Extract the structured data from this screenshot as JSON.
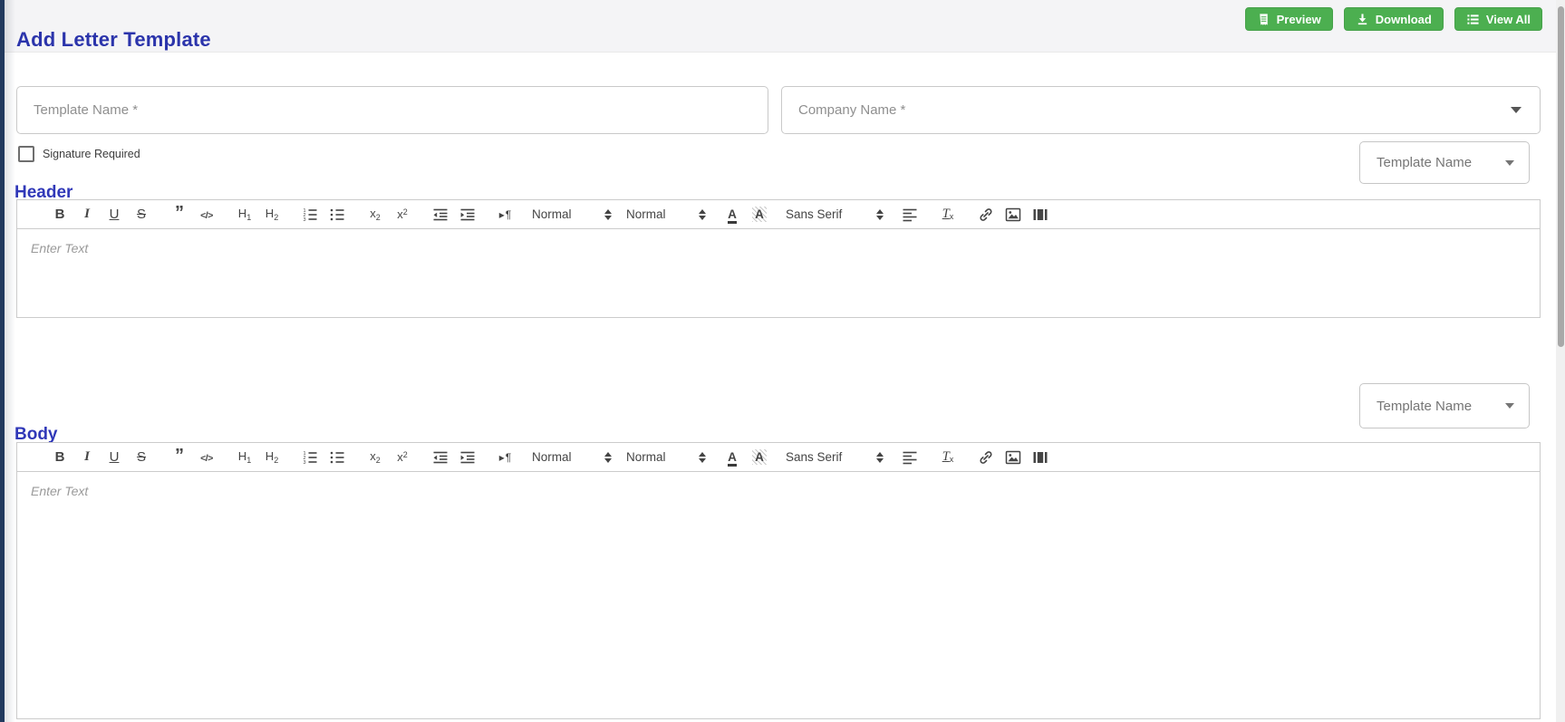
{
  "title": "Add Letter Template",
  "topbar": {
    "buttons": [
      {
        "label": "Preview",
        "icon": "receipt-icon"
      },
      {
        "label": "Download",
        "icon": "download-icon"
      },
      {
        "label": "View All",
        "icon": "list-view-icon"
      }
    ]
  },
  "form": {
    "template_name": {
      "placeholder": "Template Name *",
      "value": ""
    },
    "company_name": {
      "placeholder": "Company Name *",
      "value": ""
    },
    "signature_required": {
      "label": "Signature Required",
      "checked": false
    }
  },
  "sections": [
    {
      "title": "Header",
      "merge_dropdown": {
        "value": "Template Name"
      },
      "editor": {
        "placeholder": "Enter Text",
        "value": ""
      }
    },
    {
      "title": "Body",
      "merge_dropdown": {
        "value": "Template Name"
      },
      "editor": {
        "placeholder": "Enter Text",
        "value": ""
      }
    }
  ],
  "editor_toolbar": {
    "groups": [
      {
        "items": [
          "bold",
          "italic",
          "underline",
          "strike"
        ]
      },
      {
        "items": [
          "blockquote",
          "code-block"
        ]
      },
      {
        "items": [
          "header-1",
          "header-2"
        ]
      },
      {
        "items": [
          "ordered-list",
          "bullet-list"
        ]
      },
      {
        "items": [
          "subscript",
          "superscript"
        ]
      },
      {
        "items": [
          "outdent",
          "indent"
        ]
      },
      {
        "items": [
          "direction-rtl"
        ]
      },
      {
        "items": [
          "size-select"
        ]
      },
      {
        "items": [
          "heading-select"
        ]
      },
      {
        "items": [
          "text-color",
          "background-color"
        ]
      },
      {
        "items": [
          "font-select"
        ]
      },
      {
        "items": [
          "align"
        ]
      },
      {
        "items": [
          "clean-formatting"
        ]
      },
      {
        "items": [
          "insert-link",
          "insert-image",
          "insert-video"
        ]
      }
    ],
    "selects": {
      "size-select": "Normal",
      "heading-select": "Normal",
      "font-select": "Sans Serif"
    }
  },
  "colors": {
    "title_blue": "#2b34ab",
    "section_blue": "#3038b8",
    "button_green": "#4caf50",
    "left_edge_navy": "#223a5e"
  }
}
